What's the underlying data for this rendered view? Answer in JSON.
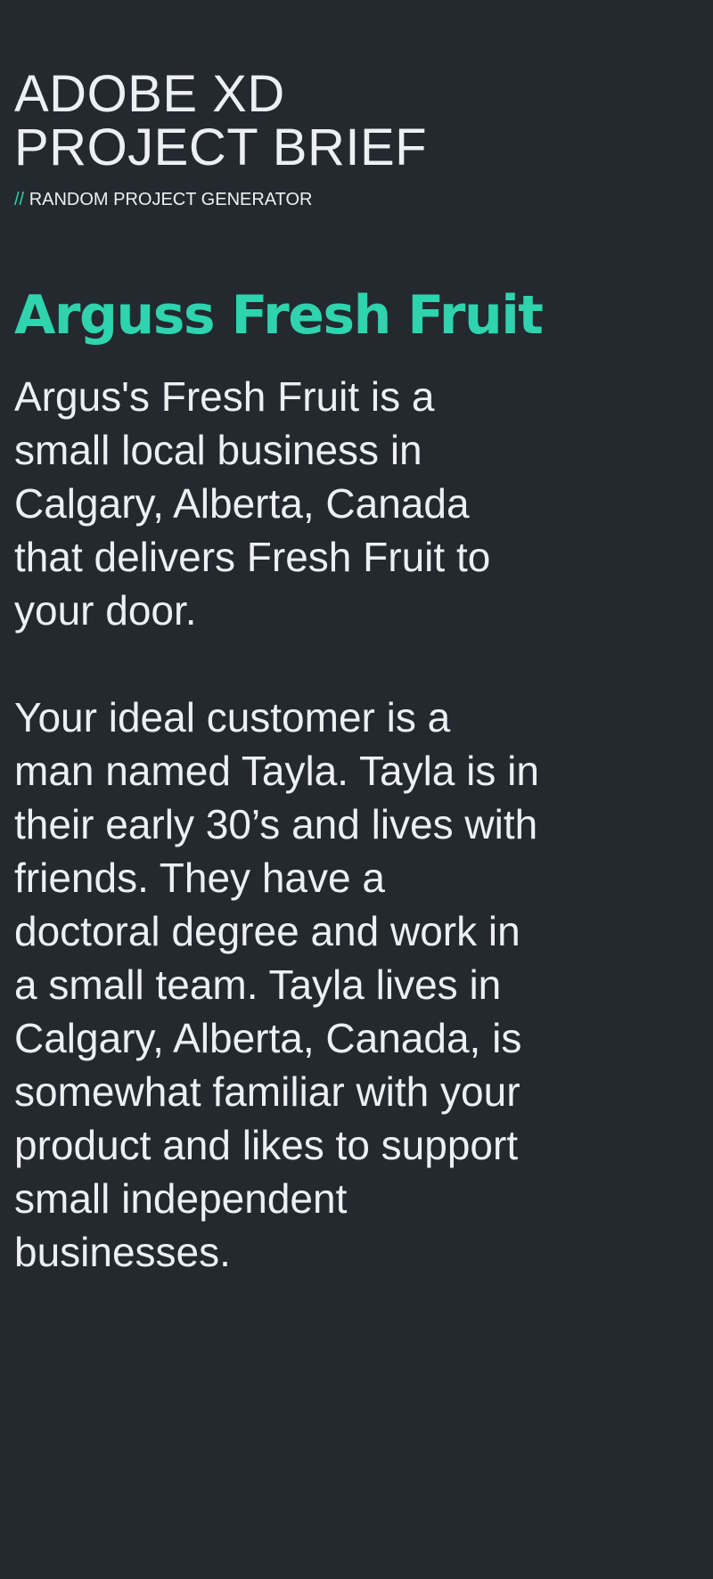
{
  "header": {
    "title_line1": "ADOBE XD",
    "title_line2": "PROJECT BRIEF",
    "subtitle_prefix": "//",
    "subtitle": "RANDOM PROJECT GENERATOR"
  },
  "project": {
    "name": "Arguss Fresh Fruit",
    "description": "Argus's Fresh Fruit is a small local business in Calgary, Alberta, Canada that delivers Fresh Fruit to your door.",
    "customer": "Your ideal customer is a man named Tayla. Tayla is in their early 30’s and lives with friends. They have a doctoral degree and work in a small team. Tayla lives in Calgary, Alberta, Canada, is somewhat familiar with your product and likes to support small independent businesses."
  },
  "colors": {
    "background": "#23292f",
    "text": "#edf0f3",
    "accent": "#2fd3ad"
  }
}
